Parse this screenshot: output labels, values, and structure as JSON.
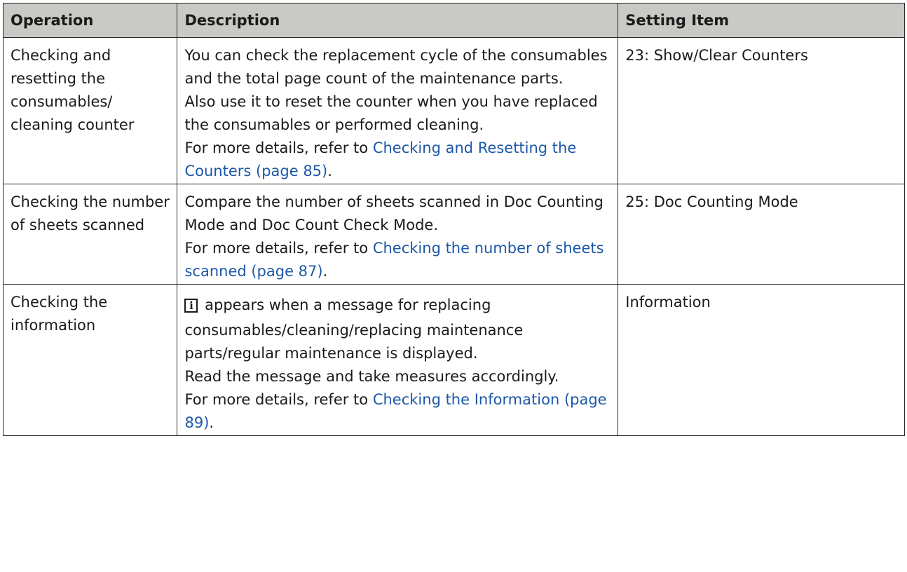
{
  "table": {
    "headers": {
      "operation": "Operation",
      "description": "Description",
      "setting_item": "Setting Item"
    },
    "rows": [
      {
        "operation": "Checking and resetting the consumables/ cleaning counter",
        "desc_lines": [
          "You can check the replacement cycle of the consumables and the total page count of the maintenance parts.",
          "Also use it to reset the counter when you have replaced the consumables or performed cleaning."
        ],
        "ref_prefix": "For more details, refer to ",
        "ref_link": "Checking and Resetting the Counters (page 85)",
        "ref_suffix": ".",
        "setting": "23: Show/Clear Counters"
      },
      {
        "operation": "Checking the number of sheets scanned",
        "desc_lines": [
          "Compare the number of sheets scanned in Doc Counting Mode and Doc Count Check Mode."
        ],
        "ref_prefix": "For more details, refer to ",
        "ref_link": "Checking the number of sheets scanned (page 87)",
        "ref_suffix": ".",
        "setting": "25: Doc Counting Mode"
      },
      {
        "operation": "Checking the information",
        "icon": "information-icon",
        "icon_glyph": "i",
        "icon_text_first": "appears when a message for replacing",
        "desc_lines": [
          "consumables/cleaning/replacing maintenance parts/regular maintenance is displayed.",
          "Read the message and take measures accordingly."
        ],
        "ref_prefix": "For more details, refer to ",
        "ref_link": "Checking the Information (page 89)",
        "ref_suffix": ".",
        "setting": "Information"
      }
    ]
  }
}
